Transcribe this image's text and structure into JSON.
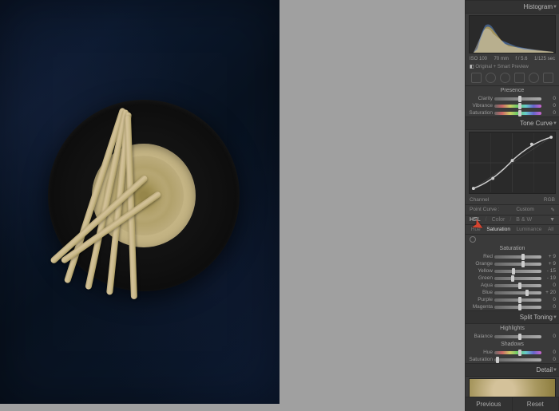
{
  "panels": {
    "histogram": {
      "title": "Histogram"
    },
    "tone_curve": {
      "title": "Tone Curve"
    },
    "split_toning": {
      "title": "Split Toning"
    },
    "detail": {
      "title": "Detail"
    }
  },
  "meta": {
    "iso": "ISO 100",
    "focal": "70 mm",
    "aperture": "f / 5.6",
    "shutter": "1/125 sec"
  },
  "preview_status": "Original + Smart Preview",
  "presence": {
    "title": "Presence",
    "sliders": [
      {
        "label": "Clarity",
        "value": "0",
        "thumb": 50
      },
      {
        "label": "Vibrance",
        "value": "0",
        "thumb": 50
      },
      {
        "label": "Saturation",
        "value": "0",
        "thumb": 50
      }
    ]
  },
  "curve": {
    "channel_label": "Channel",
    "channel_value": "RGB",
    "point_label": "Point Curve :",
    "point_value": "Custom"
  },
  "hsl": {
    "tabs": [
      "HSL",
      "Color",
      "B & W"
    ],
    "active_tab": "HSL",
    "subtabs": [
      "Hue",
      "Saturation",
      "Luminance",
      "All"
    ],
    "active_subtab": "Saturation",
    "section_title": "Saturation",
    "sliders": [
      {
        "label": "Red",
        "value": "+ 9",
        "thumb": 57
      },
      {
        "label": "Orange",
        "value": "+ 9",
        "thumb": 57
      },
      {
        "label": "Yellow",
        "value": "- 15",
        "thumb": 38
      },
      {
        "label": "Green",
        "value": "- 19",
        "thumb": 35
      },
      {
        "label": "Aqua",
        "value": "0",
        "thumb": 50
      },
      {
        "label": "Blue",
        "value": "+ 20",
        "thumb": 66
      },
      {
        "label": "Purple",
        "value": "0",
        "thumb": 50
      },
      {
        "label": "Magenta",
        "value": "0",
        "thumb": 50
      }
    ]
  },
  "split_toning": {
    "highlights_label": "Highlights",
    "shadows_label": "Shadows",
    "sliders_h": [
      {
        "label": "Balance",
        "value": "0",
        "thumb": 50
      }
    ],
    "sliders_s": [
      {
        "label": "Hue",
        "value": "0",
        "thumb": 50
      },
      {
        "label": "Saturation",
        "value": "0",
        "thumb": 3
      }
    ]
  },
  "footer": {
    "prev": "Previous",
    "reset": "Reset"
  }
}
